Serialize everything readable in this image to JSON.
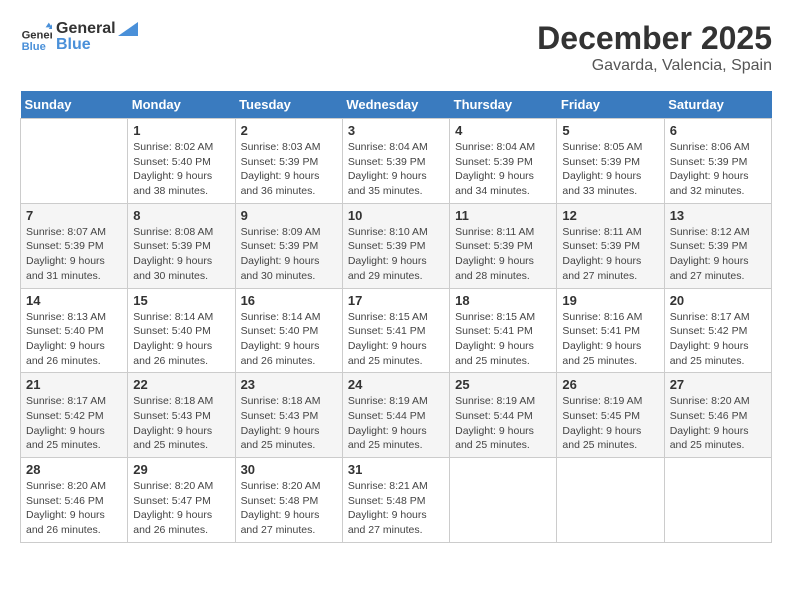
{
  "header": {
    "logo_line1": "General",
    "logo_line2": "Blue",
    "month": "December 2025",
    "location": "Gavarda, Valencia, Spain"
  },
  "weekdays": [
    "Sunday",
    "Monday",
    "Tuesday",
    "Wednesday",
    "Thursday",
    "Friday",
    "Saturday"
  ],
  "weeks": [
    [
      {
        "day": "",
        "info": ""
      },
      {
        "day": "1",
        "info": "Sunrise: 8:02 AM\nSunset: 5:40 PM\nDaylight: 9 hours\nand 38 minutes."
      },
      {
        "day": "2",
        "info": "Sunrise: 8:03 AM\nSunset: 5:39 PM\nDaylight: 9 hours\nand 36 minutes."
      },
      {
        "day": "3",
        "info": "Sunrise: 8:04 AM\nSunset: 5:39 PM\nDaylight: 9 hours\nand 35 minutes."
      },
      {
        "day": "4",
        "info": "Sunrise: 8:04 AM\nSunset: 5:39 PM\nDaylight: 9 hours\nand 34 minutes."
      },
      {
        "day": "5",
        "info": "Sunrise: 8:05 AM\nSunset: 5:39 PM\nDaylight: 9 hours\nand 33 minutes."
      },
      {
        "day": "6",
        "info": "Sunrise: 8:06 AM\nSunset: 5:39 PM\nDaylight: 9 hours\nand 32 minutes."
      }
    ],
    [
      {
        "day": "7",
        "info": "Sunrise: 8:07 AM\nSunset: 5:39 PM\nDaylight: 9 hours\nand 31 minutes."
      },
      {
        "day": "8",
        "info": "Sunrise: 8:08 AM\nSunset: 5:39 PM\nDaylight: 9 hours\nand 30 minutes."
      },
      {
        "day": "9",
        "info": "Sunrise: 8:09 AM\nSunset: 5:39 PM\nDaylight: 9 hours\nand 30 minutes."
      },
      {
        "day": "10",
        "info": "Sunrise: 8:10 AM\nSunset: 5:39 PM\nDaylight: 9 hours\nand 29 minutes."
      },
      {
        "day": "11",
        "info": "Sunrise: 8:11 AM\nSunset: 5:39 PM\nDaylight: 9 hours\nand 28 minutes."
      },
      {
        "day": "12",
        "info": "Sunrise: 8:11 AM\nSunset: 5:39 PM\nDaylight: 9 hours\nand 27 minutes."
      },
      {
        "day": "13",
        "info": "Sunrise: 8:12 AM\nSunset: 5:39 PM\nDaylight: 9 hours\nand 27 minutes."
      }
    ],
    [
      {
        "day": "14",
        "info": "Sunrise: 8:13 AM\nSunset: 5:40 PM\nDaylight: 9 hours\nand 26 minutes."
      },
      {
        "day": "15",
        "info": "Sunrise: 8:14 AM\nSunset: 5:40 PM\nDaylight: 9 hours\nand 26 minutes."
      },
      {
        "day": "16",
        "info": "Sunrise: 8:14 AM\nSunset: 5:40 PM\nDaylight: 9 hours\nand 26 minutes."
      },
      {
        "day": "17",
        "info": "Sunrise: 8:15 AM\nSunset: 5:41 PM\nDaylight: 9 hours\nand 25 minutes."
      },
      {
        "day": "18",
        "info": "Sunrise: 8:15 AM\nSunset: 5:41 PM\nDaylight: 9 hours\nand 25 minutes."
      },
      {
        "day": "19",
        "info": "Sunrise: 8:16 AM\nSunset: 5:41 PM\nDaylight: 9 hours\nand 25 minutes."
      },
      {
        "day": "20",
        "info": "Sunrise: 8:17 AM\nSunset: 5:42 PM\nDaylight: 9 hours\nand 25 minutes."
      }
    ],
    [
      {
        "day": "21",
        "info": "Sunrise: 8:17 AM\nSunset: 5:42 PM\nDaylight: 9 hours\nand 25 minutes."
      },
      {
        "day": "22",
        "info": "Sunrise: 8:18 AM\nSunset: 5:43 PM\nDaylight: 9 hours\nand 25 minutes."
      },
      {
        "day": "23",
        "info": "Sunrise: 8:18 AM\nSunset: 5:43 PM\nDaylight: 9 hours\nand 25 minutes."
      },
      {
        "day": "24",
        "info": "Sunrise: 8:19 AM\nSunset: 5:44 PM\nDaylight: 9 hours\nand 25 minutes."
      },
      {
        "day": "25",
        "info": "Sunrise: 8:19 AM\nSunset: 5:44 PM\nDaylight: 9 hours\nand 25 minutes."
      },
      {
        "day": "26",
        "info": "Sunrise: 8:19 AM\nSunset: 5:45 PM\nDaylight: 9 hours\nand 25 minutes."
      },
      {
        "day": "27",
        "info": "Sunrise: 8:20 AM\nSunset: 5:46 PM\nDaylight: 9 hours\nand 25 minutes."
      }
    ],
    [
      {
        "day": "28",
        "info": "Sunrise: 8:20 AM\nSunset: 5:46 PM\nDaylight: 9 hours\nand 26 minutes."
      },
      {
        "day": "29",
        "info": "Sunrise: 8:20 AM\nSunset: 5:47 PM\nDaylight: 9 hours\nand 26 minutes."
      },
      {
        "day": "30",
        "info": "Sunrise: 8:20 AM\nSunset: 5:48 PM\nDaylight: 9 hours\nand 27 minutes."
      },
      {
        "day": "31",
        "info": "Sunrise: 8:21 AM\nSunset: 5:48 PM\nDaylight: 9 hours\nand 27 minutes."
      },
      {
        "day": "",
        "info": ""
      },
      {
        "day": "",
        "info": ""
      },
      {
        "day": "",
        "info": ""
      }
    ]
  ]
}
